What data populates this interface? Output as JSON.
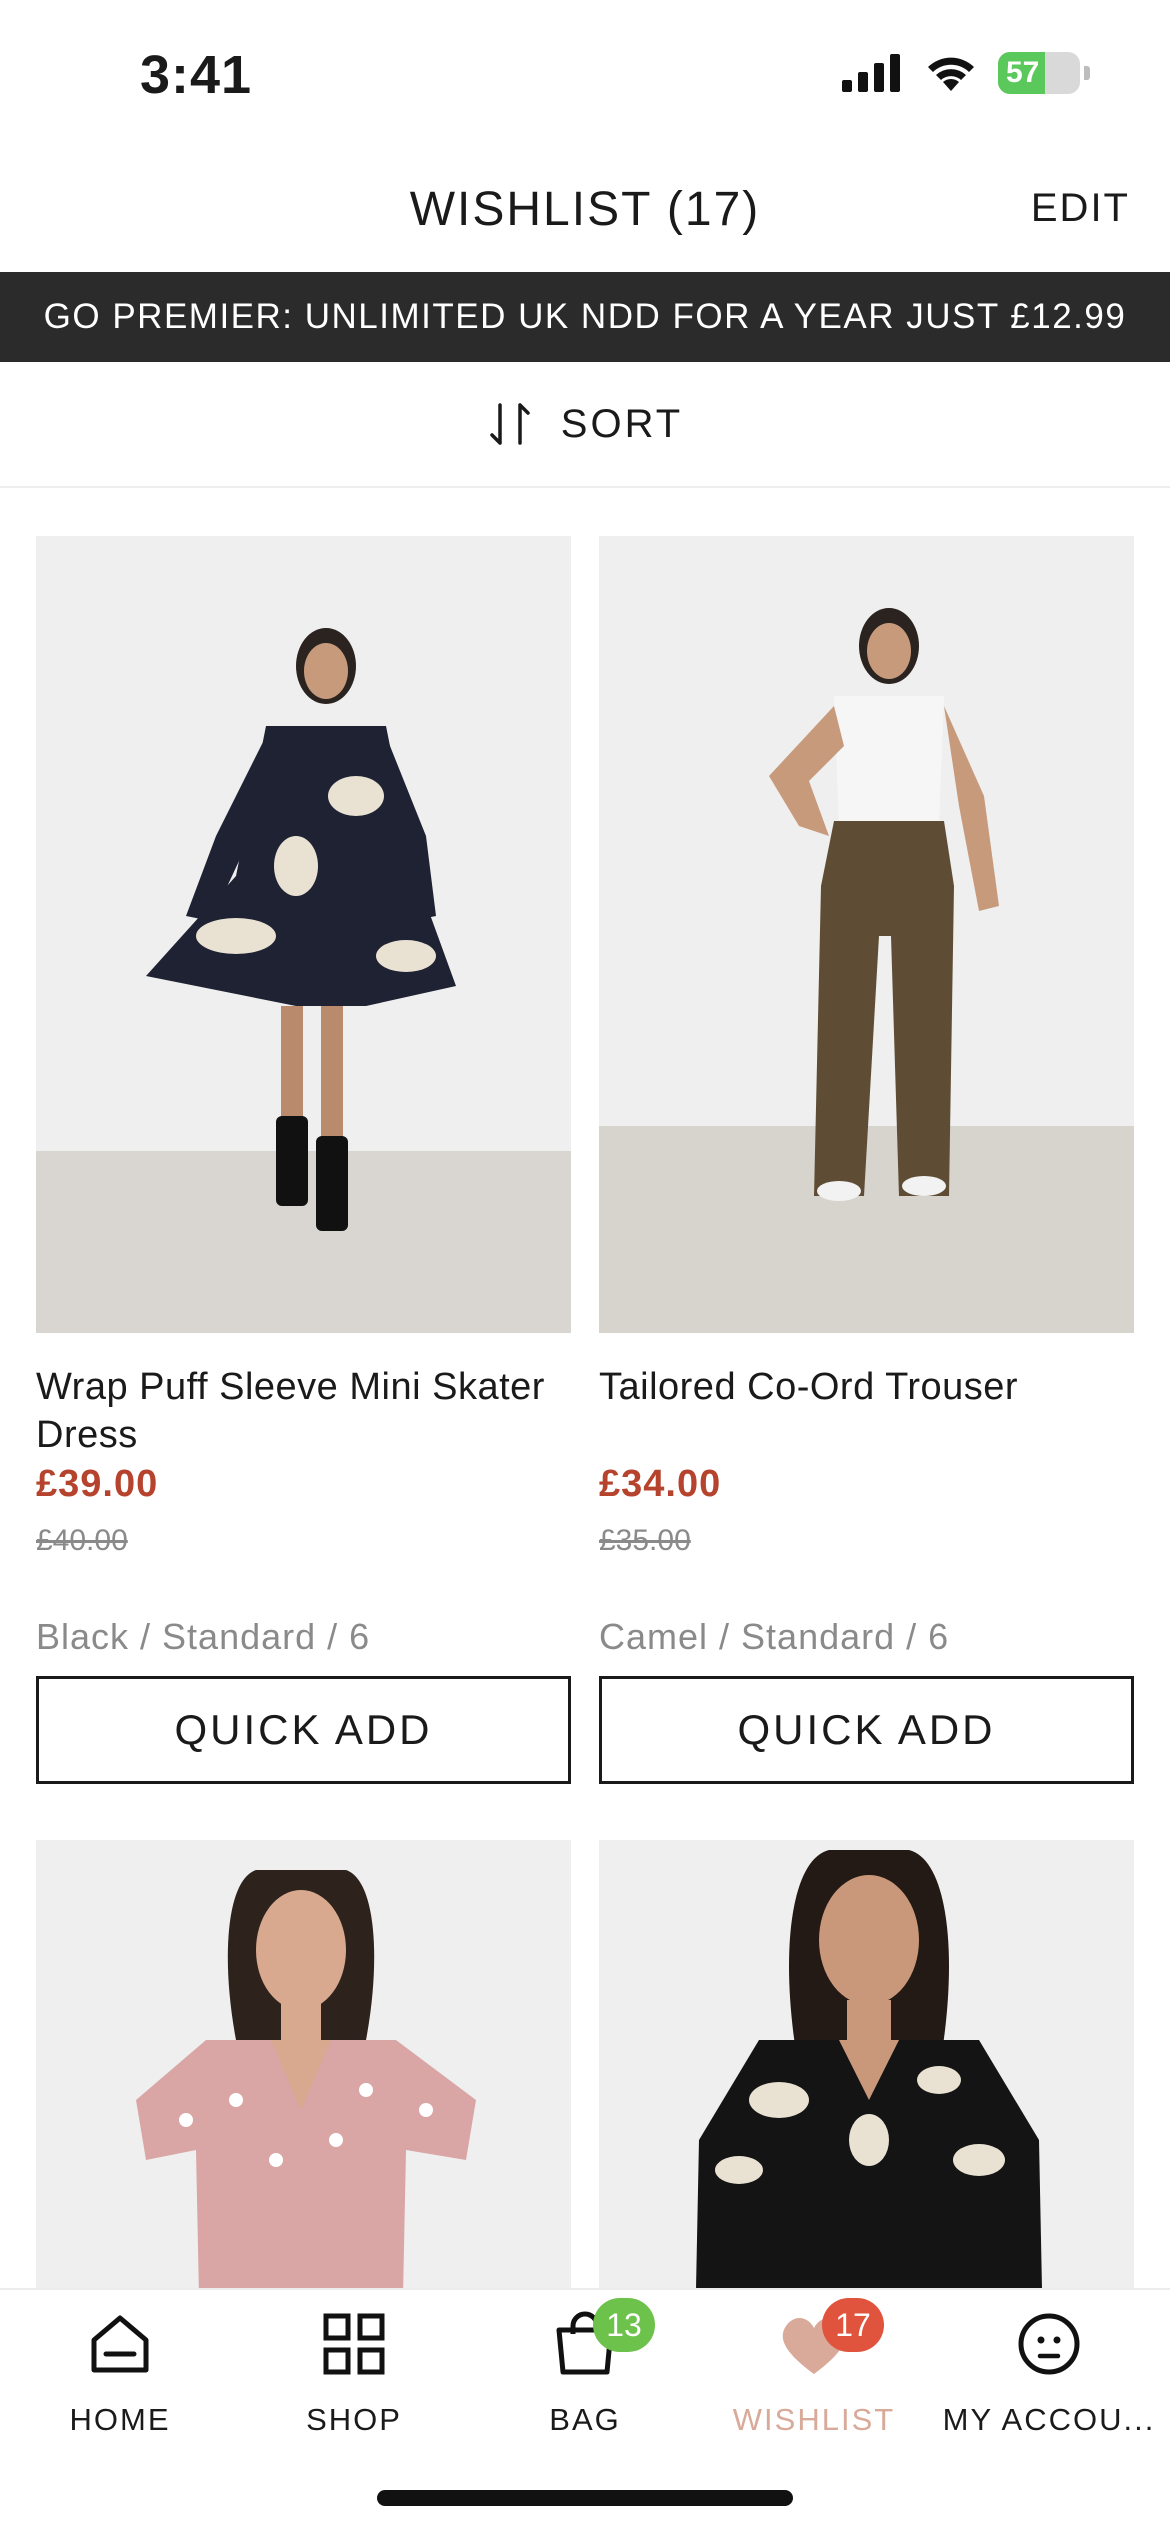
{
  "status_bar": {
    "time": "3:41",
    "battery": "57",
    "battery_level": 0.57
  },
  "header": {
    "title": "WISHLIST (17)",
    "edit_label": "EDIT"
  },
  "promo": {
    "text": "GO PREMIER: UNLIMITED UK NDD FOR A YEAR JUST £12.99"
  },
  "sort": {
    "label": "SORT",
    "icon": "sort-arrows-icon"
  },
  "products": [
    {
      "name": "Wrap Puff Sleeve Mini Skater Dress",
      "price": "£39.00",
      "was_price": "£40.00",
      "variant": "Black / Standard / 6",
      "button": "QUICK ADD"
    },
    {
      "name": "Tailored Co-Ord Trouser",
      "price": "£34.00",
      "was_price": "£35.00",
      "variant": "Camel / Standard / 6",
      "button": "QUICK ADD"
    },
    {
      "name": "",
      "price": "",
      "was_price": "",
      "variant": "",
      "button": ""
    },
    {
      "name": "",
      "price": "",
      "was_price": "",
      "variant": "",
      "button": ""
    }
  ],
  "tabbar": {
    "items": [
      {
        "label": "HOME",
        "icon": "home-icon"
      },
      {
        "label": "SHOP",
        "icon": "grid-icon"
      },
      {
        "label": "BAG",
        "icon": "bag-icon",
        "badge": "13"
      },
      {
        "label": "WISHLIST",
        "icon": "heart-icon",
        "badge": "17"
      },
      {
        "label": "MY ACCOU...",
        "icon": "account-icon"
      }
    ],
    "active_color": "#d9a99a",
    "bag_badge_color": "#6cc24a",
    "wishlist_badge_color": "#e0533d"
  },
  "colors": {
    "price_red": "#b5432d",
    "banner_bg": "#2b2b2b"
  }
}
